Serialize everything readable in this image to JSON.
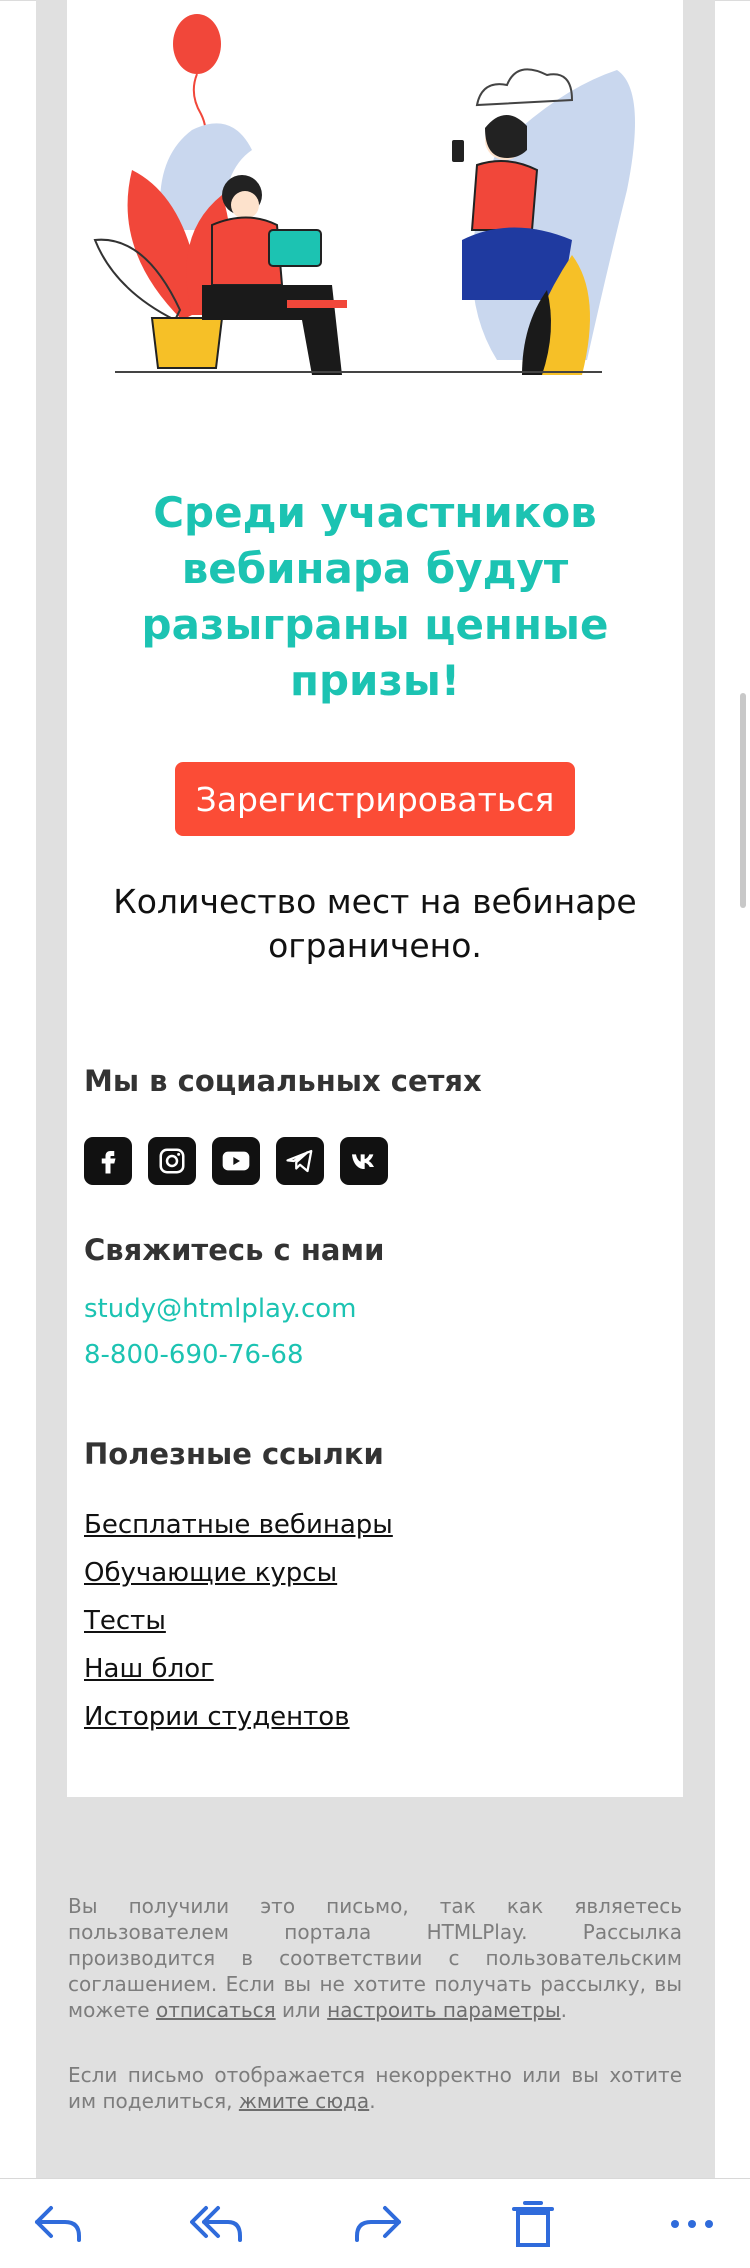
{
  "headline": {
    "line1": "Среди участников",
    "line2": "вебинара будут",
    "line3": "разыграны ценные",
    "line4": "призы!"
  },
  "register_button": {
    "label": "Зарегистрироваться"
  },
  "limited": {
    "line1": "Количество мест на вебинаре",
    "line2": "ограничено."
  },
  "social": {
    "title": "Мы в социальных сетях",
    "icons": [
      "facebook-icon",
      "instagram-icon",
      "youtube-icon",
      "telegram-icon",
      "vk-icon"
    ]
  },
  "contact": {
    "title": "Свяжитесь с нами",
    "email": "study@htmlplay.com",
    "phone": "8-800-690-76-68"
  },
  "useful": {
    "title": "Полезные ссылки",
    "links": [
      "Бесплатные вебинары",
      "Обучающие курсы",
      "Тесты",
      "Наш блог",
      "Истории студентов"
    ]
  },
  "footer": {
    "p1_before": "Вы получили это письмо, так как являетесь пользователем портала HTMLPlay. Рассылка производится в соответствии с пользовательским соглашением. Если вы не хотите получать рассылку, вы можете ",
    "p1_link1": "отписаться",
    "p1_mid": " или ",
    "p1_link2": "настроить параметры",
    "p1_end": ".",
    "p2_before": "Если письмо отображается некорректно или вы хотите им поделиться, ",
    "p2_link": "жмите сюда",
    "p2_end": "."
  },
  "toolbar": {
    "icons": [
      "reply-icon",
      "reply-all-icon",
      "forward-icon",
      "delete-icon",
      "more-icon"
    ]
  },
  "colors": {
    "accent": "#1cc3b2",
    "button": "#fb4c36",
    "toolbar_icon": "#2f6bdb"
  }
}
